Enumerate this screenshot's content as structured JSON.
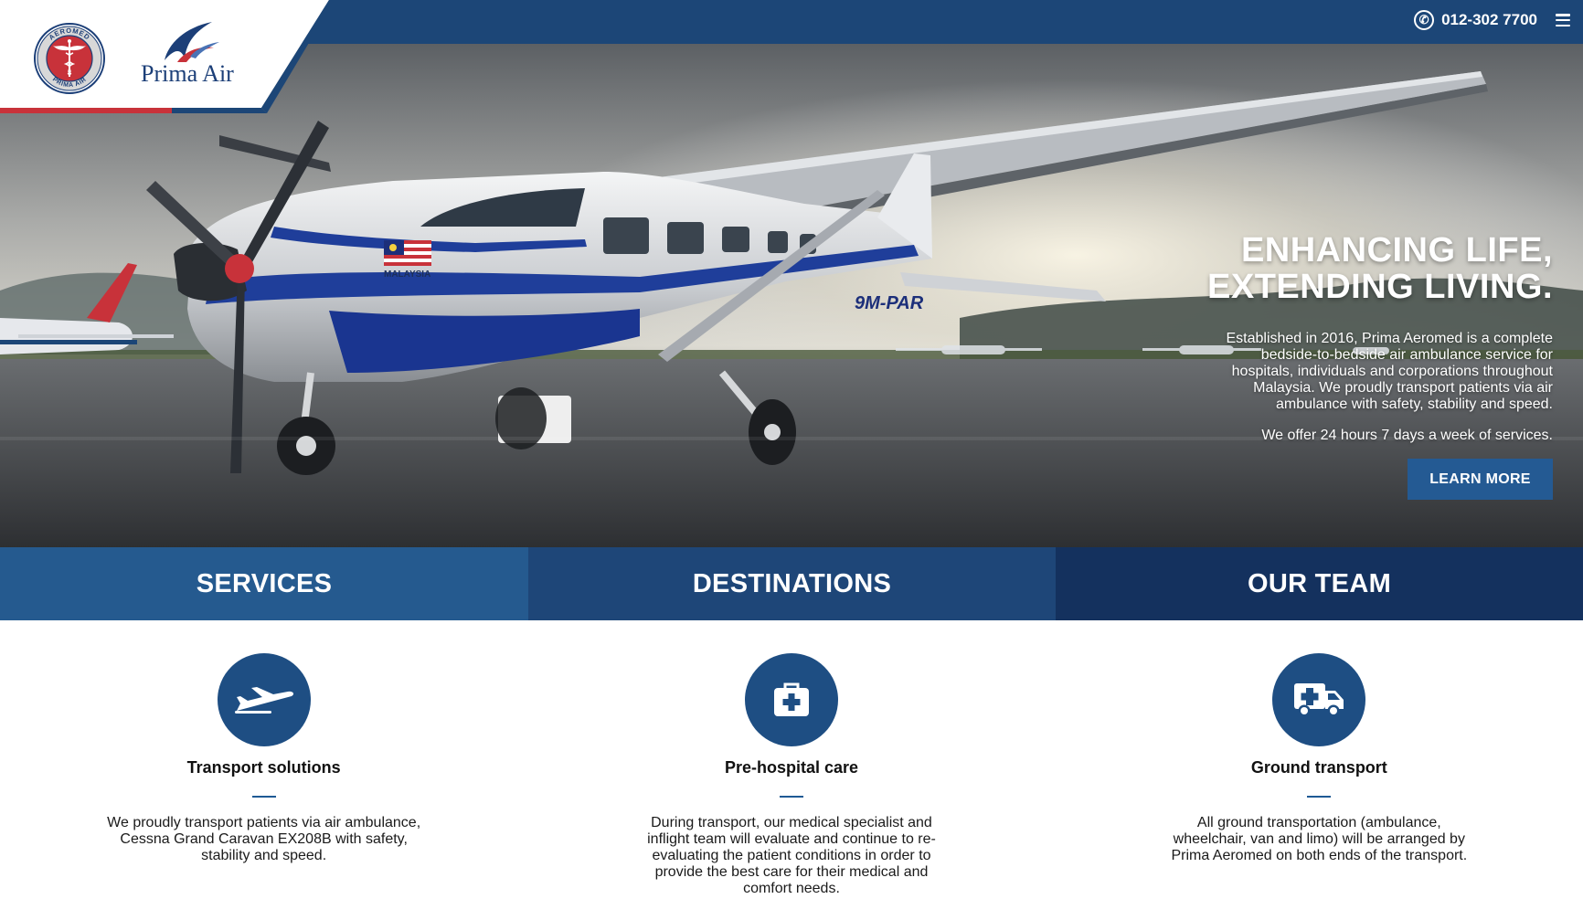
{
  "header": {
    "phone": "012-302 7700",
    "phone_icon": "phone-icon",
    "menu_icon": "hamburger-menu-icon",
    "bar_color": "#1c4677"
  },
  "logos": {
    "seal_top_text": "AEROMED",
    "seal_bottom_text": "PRIMA AIR",
    "brand_name": "Prima Air"
  },
  "hero": {
    "title_line1": "ENHANCING LIFE,",
    "title_line2": "EXTENDING LIVING.",
    "description": "Established in 2016, Prima Aeromed is a complete bedside-to-bedside air ambulance service for hospitals, individuals and corporations throughout Malaysia. We proudly transport patients via air ambulance with safety, stability and speed.",
    "availability": "We offer 24 hours 7 days a week of services.",
    "cta_label": "LEARN MORE",
    "aircraft_flag_text": "MALAYSIA",
    "aircraft_registration": "9M-PAR"
  },
  "tabs": [
    {
      "label": "SERVICES",
      "color": "#255a8f"
    },
    {
      "label": "DESTINATIONS",
      "color": "#1e4678"
    },
    {
      "label": "OUR TEAM",
      "color": "#14315e"
    }
  ],
  "services": [
    {
      "icon": "airplane-icon",
      "title": "Transport solutions",
      "text": "We proudly transport patients via air ambulance, Cessna Grand Caravan EX208B with safety, stability and speed."
    },
    {
      "icon": "first-aid-kit-icon",
      "title": "Pre-hospital care",
      "text": "During transport, our medical specialist and inflight team will evaluate and continue to re-evaluating the patient conditions in order to provide the best care for their medical and comfort needs."
    },
    {
      "icon": "ambulance-icon",
      "title": "Ground transport",
      "text": "All ground transportation (ambulance, wheelchair, van and limo) will be arranged by Prima Aeromed on both ends of the transport."
    }
  ],
  "colors": {
    "brand_blue": "#1c4677",
    "accent_red": "#c8323a",
    "icon_circle": "#1e4e83"
  }
}
